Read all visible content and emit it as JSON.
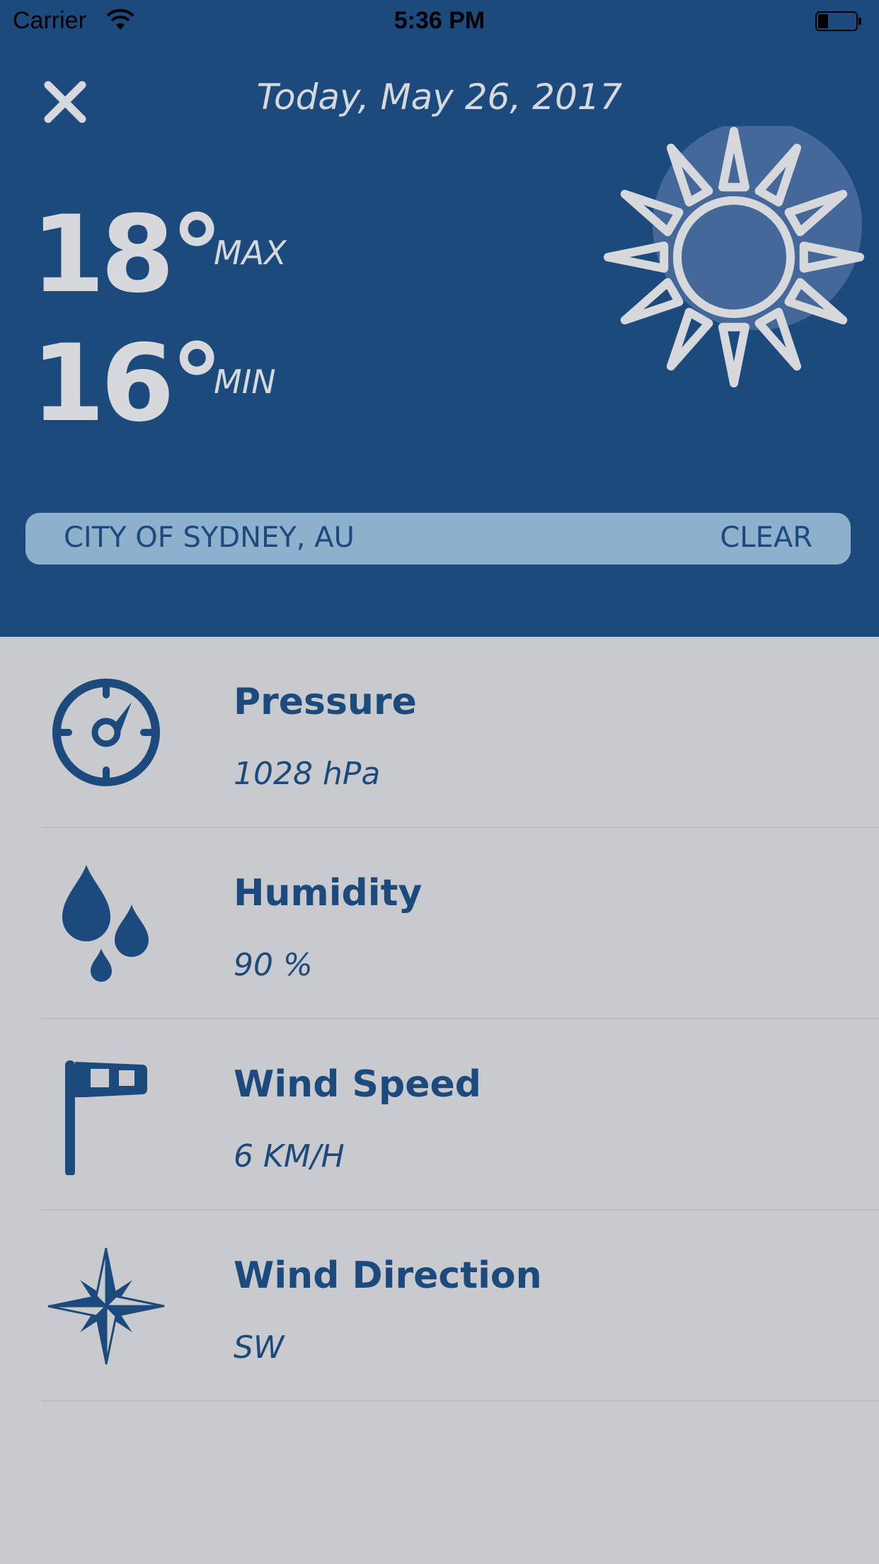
{
  "status_bar": {
    "carrier": "Carrier",
    "time": "5:36 PM"
  },
  "header": {
    "date": "Today, May 26, 2017",
    "max_temp": "18°",
    "max_label": "MAX",
    "min_temp": "16°",
    "min_label": "MIN",
    "weather_icon": "sun-icon"
  },
  "location": {
    "name": "CITY OF SYDNEY, AU",
    "clear_label": "CLEAR"
  },
  "details": [
    {
      "label": "Pressure",
      "value": "1028 hPa",
      "icon": "compass-gauge-icon"
    },
    {
      "label": "Humidity",
      "value": "90 %",
      "icon": "water-drops-icon"
    },
    {
      "label": "Wind Speed",
      "value": "6 KM/H",
      "icon": "windsock-flag-icon"
    },
    {
      "label": "Wind Direction",
      "value": "SW",
      "icon": "compass-rose-icon"
    }
  ],
  "colors": {
    "header_bg": "#1c4a7d",
    "body_bg": "#c9cacd",
    "accent_text": "#1c4a7d",
    "light_text": "#d7d8dc",
    "location_bar_bg": "#8db0cd"
  }
}
